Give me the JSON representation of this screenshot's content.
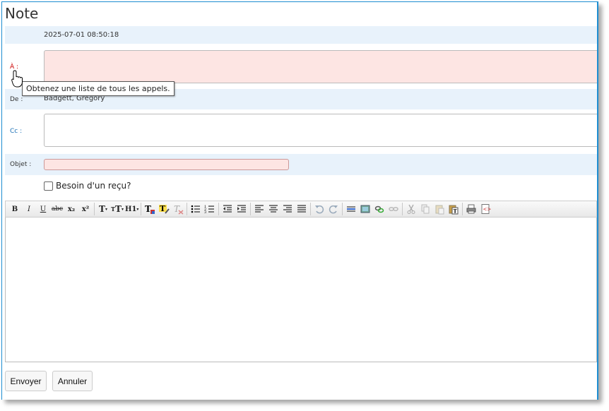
{
  "window": {
    "title": "Note"
  },
  "header": {
    "datetime": "2025-07-01 08:50:18"
  },
  "fields": {
    "to_label": "À :",
    "from_label": "De :",
    "from_value": "Badgett, Gregory",
    "cc_label": "Cc :",
    "subject_label": "Objet :",
    "to_value": "",
    "cc_value": "",
    "subject_value": ""
  },
  "tooltip": {
    "text": "Obtenez une liste de tous les appels."
  },
  "receipt": {
    "label": "Besoin d'un reçu?",
    "checked": false
  },
  "toolbar": {
    "bold": "B",
    "italic": "I",
    "underline": "U",
    "strikethrough": "abc",
    "subscript": "x₂",
    "superscript": "x²",
    "font_size": "T",
    "font_family": "T",
    "heading": "H1"
  },
  "buttons": {
    "send": "Envoyer",
    "cancel": "Annuler"
  },
  "colors": {
    "accent": "#1e8ed2",
    "required_bg": "#fde5e3",
    "band_bg": "#e8f2fb",
    "required_label": "#cc0000",
    "link_label": "#1a6fb5"
  }
}
